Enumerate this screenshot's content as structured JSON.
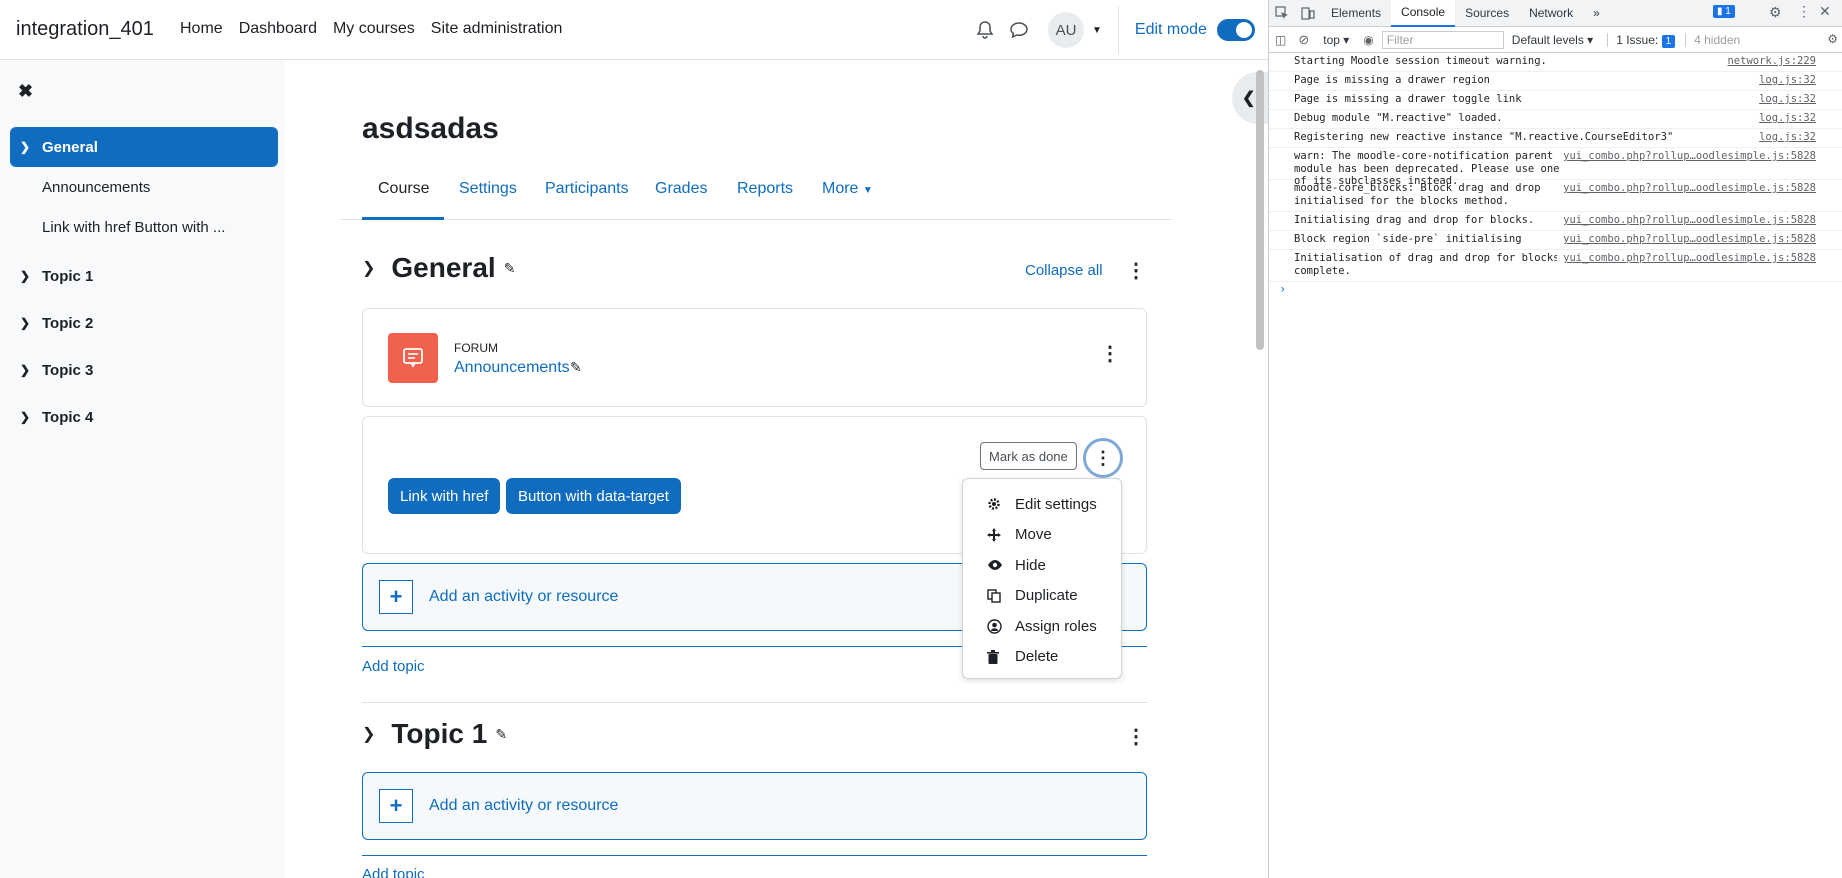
{
  "site": {
    "brand": "integration_401"
  },
  "primary_nav": [
    "Home",
    "Dashboard",
    "My courses",
    "Site administration"
  ],
  "user": {
    "initials": "AU"
  },
  "edit_mode": {
    "label": "Edit mode",
    "on": true
  },
  "drawer": {
    "items": [
      {
        "label": "General",
        "type": "section",
        "active": true
      },
      {
        "label": "Announcements",
        "type": "child"
      },
      {
        "label": "Link with href Button with ...",
        "type": "child"
      },
      {
        "label": "Topic 1",
        "type": "section"
      },
      {
        "label": "Topic 2",
        "type": "section"
      },
      {
        "label": "Topic 3",
        "type": "section"
      },
      {
        "label": "Topic 4",
        "type": "section"
      }
    ]
  },
  "course": {
    "title": "asdsadas",
    "tabs": [
      "Course",
      "Settings",
      "Participants",
      "Grades",
      "Reports",
      "More"
    ],
    "collapse_all": "Collapse all"
  },
  "sections": {
    "general": {
      "title": "General"
    },
    "topic1": {
      "title": "Topic 1"
    }
  },
  "forum": {
    "type_label": "FORUM",
    "name": "Announcements"
  },
  "html_module": {
    "mark_done": "Mark as done",
    "buttons": [
      "Link with href",
      "Button with data-target"
    ]
  },
  "add_activity": "Add an activity or resource",
  "add_topic": "Add topic",
  "action_menu": [
    "Edit settings",
    "Move",
    "Hide",
    "Duplicate",
    "Assign roles",
    "Delete"
  ],
  "devtools": {
    "tabs": [
      "Elements",
      "Console",
      "Sources",
      "Network"
    ],
    "messages_badge": "1",
    "context": "top",
    "filter_placeholder": "Filter",
    "levels": "Default levels",
    "issues": "1 Issue:",
    "issues_count": "1",
    "hidden": "4 hidden",
    "logs": [
      {
        "text": "Starting Moodle session timeout warning.",
        "src": "network.js:229"
      },
      {
        "text": "Page is missing a drawer region",
        "src": "log.js:32"
      },
      {
        "text": "Page is missing a drawer toggle link",
        "src": "log.js:32"
      },
      {
        "text": "Debug module \"M.reactive\" loaded.",
        "src": "log.js:32"
      },
      {
        "text": "Registering new reactive instance \"M.reactive.CourseEditor3\"",
        "src": "log.js:32"
      },
      {
        "text": "warn: The moodle-core-notification parent module has been deprecated. Please use one of its subclasses instead.",
        "src": "yui_combo.php?rollup…oodlesimple.js:5828"
      },
      {
        "text": "moodle-core_blocks: Block drag and drop initialised for the blocks method.",
        "src": "yui_combo.php?rollup…oodlesimple.js:5828"
      },
      {
        "text": "Initialising drag and drop for blocks.",
        "src": "yui_combo.php?rollup…oodlesimple.js:5828"
      },
      {
        "text": "Block region `side-pre` initialising",
        "src": "yui_combo.php?rollup…oodlesimple.js:5828"
      },
      {
        "text": "Initialisation of drag and drop for blocks complete.",
        "src": "yui_combo.php?rollup…oodlesimple.js:5828"
      }
    ]
  }
}
